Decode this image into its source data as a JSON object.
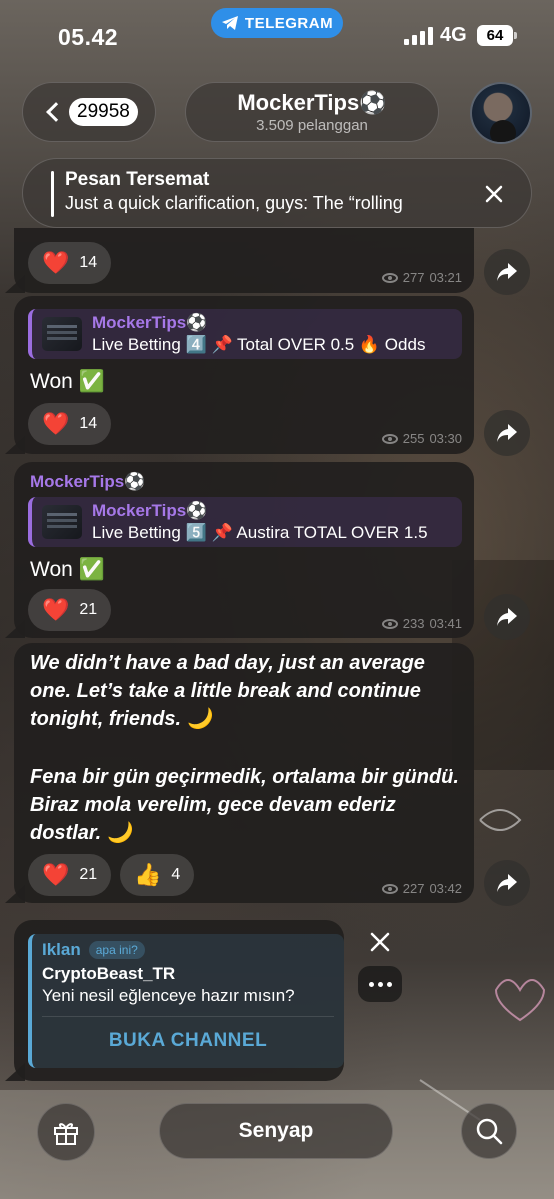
{
  "status": {
    "time": "05.42",
    "return_pill": "TELEGRAM",
    "network": "4G",
    "battery": "64"
  },
  "header": {
    "unread_count": "29958",
    "channel_title": "MockerTips⚽️",
    "subscribers": "3.509 pelanggan"
  },
  "pinned": {
    "title": "Pesan Tersemat",
    "text": "Just a quick clarification, guys: The “rolling"
  },
  "messages": [
    {
      "reaction_emoji": "❤️",
      "reaction_count": "14",
      "views": "277",
      "time": "03:21"
    },
    {
      "reply_author": "MockerTips⚽️",
      "reply_text": "Live Betting 4️⃣ 📌 Total OVER 0.5 🔥 Odds",
      "text": "Won ✅",
      "reaction_emoji": "❤️",
      "reaction_count": "14",
      "views": "255",
      "time": "03:30"
    },
    {
      "forward_author": "MockerTips⚽️",
      "reply_author": "MockerTips⚽️",
      "reply_text": "Live Betting 5️⃣ 📌 Austira TOTAL OVER 1.5",
      "text": "Won ✅",
      "reaction_emoji": "❤️",
      "reaction_count": "21",
      "views": "233",
      "time": "03:41"
    },
    {
      "text_en": "We didn’t have a bad day, just an average one. Let’s take a little break and continue tonight, friends. 🌙",
      "text_tr": "Fena bir gün geçirmedik, ortalama bir gündü. Biraz mola verelim, gece devam ederiz dostlar. 🌙",
      "reaction_emoji": "❤️",
      "reaction_count": "21",
      "reaction2_emoji": "👍",
      "reaction2_count": "4",
      "views": "227",
      "time": "03:42"
    }
  ],
  "ad": {
    "label": "Iklan",
    "info": "apa ini?",
    "name": "CryptoBeast_TR",
    "text": "Yeni nesil eğlenceye hazır mısın?",
    "cta": "BUKA CHANNEL"
  },
  "bottom": {
    "mute_label": "Senyap"
  },
  "icons": {
    "gift": "gift-icon",
    "search": "search-icon",
    "share": "share-icon",
    "eye": "eye-icon",
    "close": "close-icon"
  },
  "colors": {
    "accent_purple": "#a678e8",
    "ad_blue": "#5aa9d6",
    "telegram_blue": "#2f8fe8"
  }
}
